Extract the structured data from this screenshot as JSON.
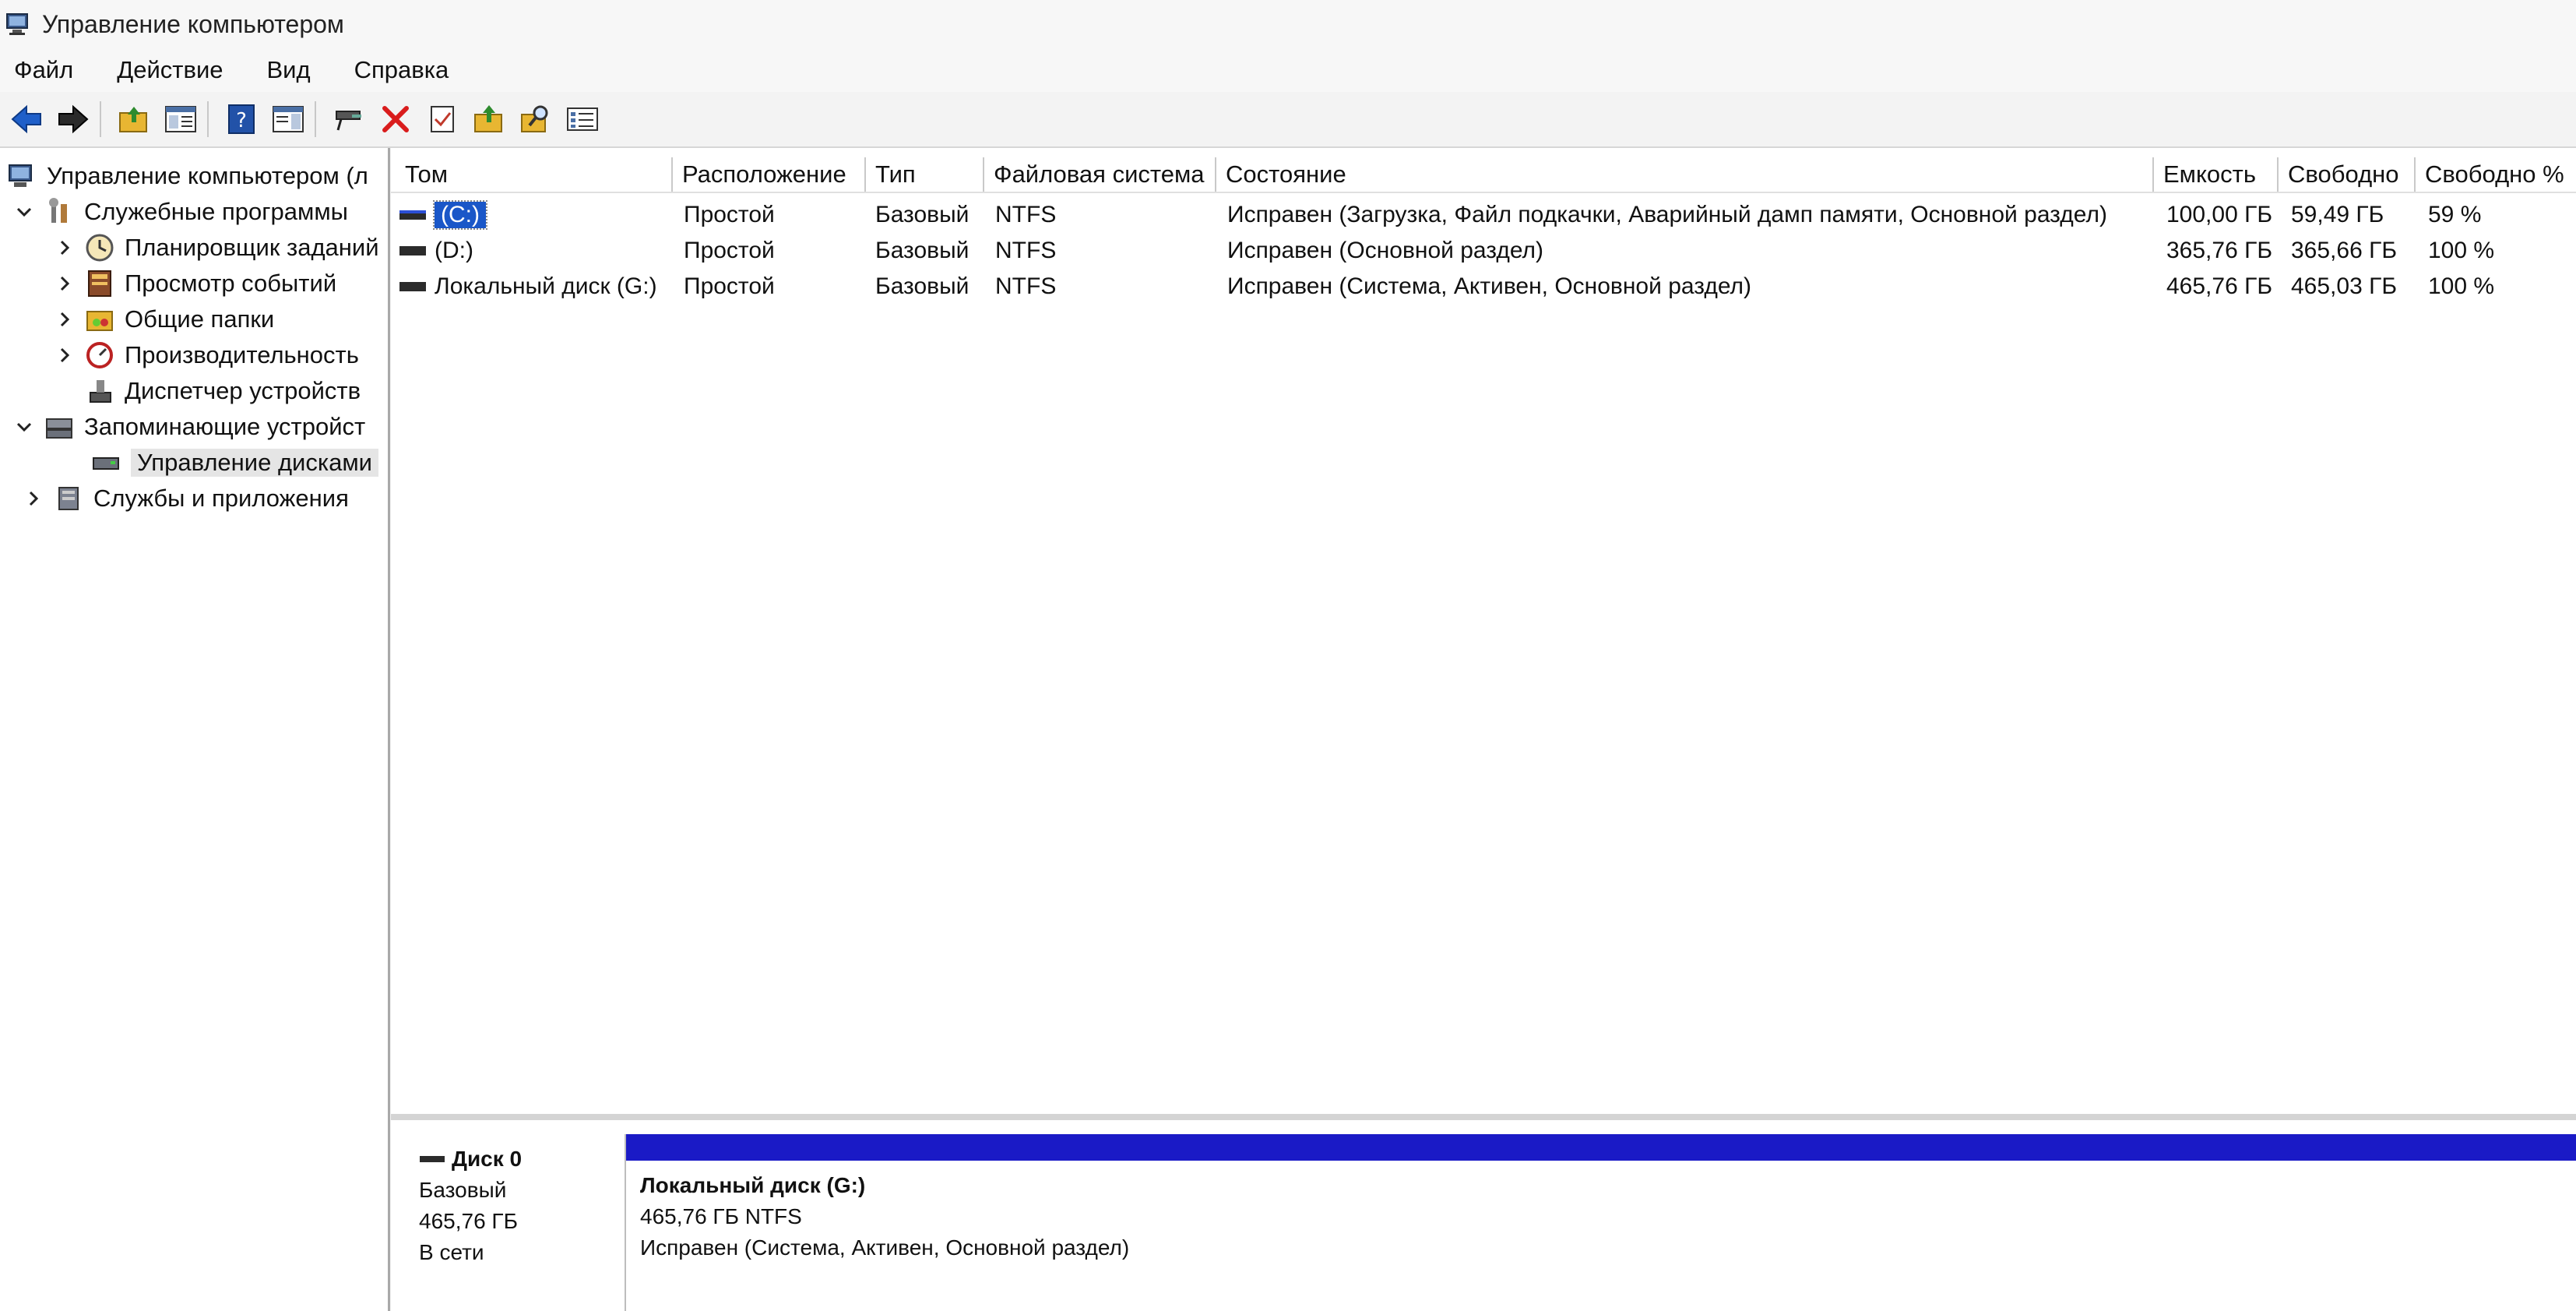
{
  "window": {
    "title": "Управление компьютером"
  },
  "menu": [
    "Файл",
    "Действие",
    "Вид",
    "Справка"
  ],
  "tree": {
    "root": "Управление компьютером (л",
    "utilities": "Служебные программы",
    "scheduler": "Планировщик заданий",
    "events": "Просмотр событий",
    "shared": "Общие папки",
    "perf": "Производительность",
    "devmgr": "Диспетчер устройств",
    "storage": "Запоминающие устройст",
    "diskmgmt": "Управление дисками",
    "services": "Службы и приложения"
  },
  "columns": {
    "tom": "Том",
    "loc": "Расположение",
    "type": "Тип",
    "fs": "Файловая система",
    "state": "Состояние",
    "cap": "Емкость",
    "free": "Свободно",
    "freepct": "Свободно %"
  },
  "volumes": [
    {
      "tom": "(C:)",
      "loc": "Простой",
      "type": "Базовый",
      "fs": "NTFS",
      "state": "Исправен (Загрузка, Файл подкачки, Аварийный дамп памяти, Основной раздел)",
      "cap": "100,00 ГБ",
      "free": "59,49 ГБ",
      "freepct": "59 %"
    },
    {
      "tom": "(D:)",
      "loc": "Простой",
      "type": "Базовый",
      "fs": "NTFS",
      "state": "Исправен (Основной раздел)",
      "cap": "365,76 ГБ",
      "free": "365,66 ГБ",
      "freepct": "100 %"
    },
    {
      "tom": "Локальный диск (G:)",
      "loc": "Простой",
      "type": "Базовый",
      "fs": "NTFS",
      "state": "Исправен (Система, Активен, Основной раздел)",
      "cap": "465,76 ГБ",
      "free": "465,03 ГБ",
      "freepct": "100 %"
    }
  ],
  "disk0": {
    "name": "Диск 0",
    "type": "Базовый",
    "size": "465,76 ГБ",
    "status": "В сети",
    "partition": {
      "name": "Локальный диск  (G:)",
      "size_fs": "465,76 ГБ NTFS",
      "state": "Исправен (Система, Активен, Основной раздел)"
    }
  },
  "colors": {
    "selection": "#1a57c8",
    "partition_bar": "#1a1ac6"
  }
}
